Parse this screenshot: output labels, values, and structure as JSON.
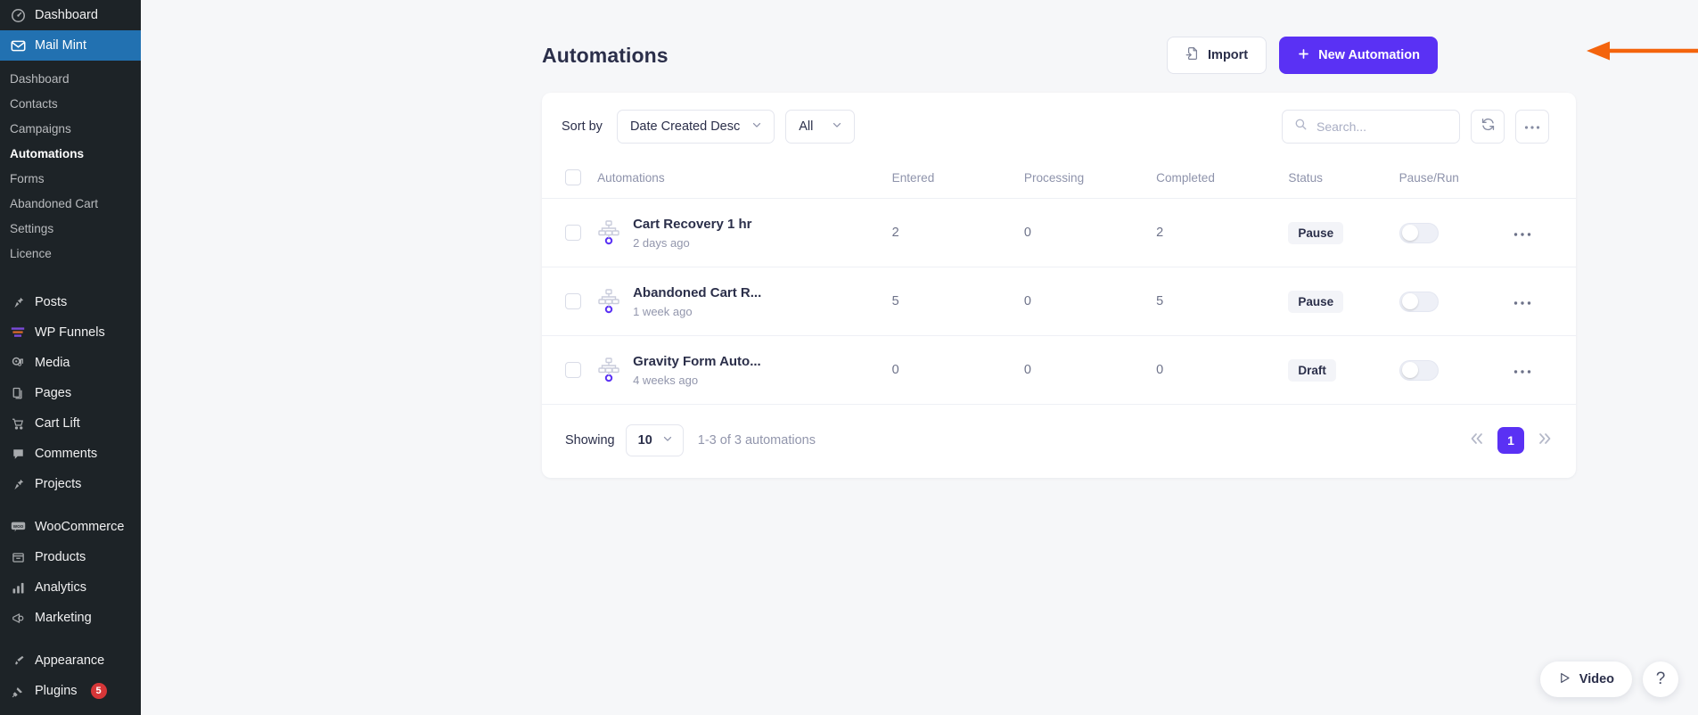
{
  "theme": {
    "accent": "#5a31f4",
    "sidebar_bg": "#1d2327",
    "sidebar_active_bg": "#2271b1",
    "page_bg": "#f6f7f9",
    "annotation_arrow": "#f4640d",
    "badge_red": "#d63638"
  },
  "sidebar": {
    "top_items": [
      {
        "label": "Dashboard",
        "icon": "dashboard-icon",
        "current": false
      },
      {
        "label": "Mail Mint",
        "icon": "mail-icon",
        "current": true
      }
    ],
    "submenu": [
      {
        "label": "Dashboard",
        "active": false
      },
      {
        "label": "Contacts",
        "active": false
      },
      {
        "label": "Campaigns",
        "active": false
      },
      {
        "label": "Automations",
        "active": true
      },
      {
        "label": "Forms",
        "active": false
      },
      {
        "label": "Abandoned Cart",
        "active": false
      },
      {
        "label": "Settings",
        "active": false
      },
      {
        "label": "Licence",
        "active": false
      }
    ],
    "group_two": [
      {
        "label": "Posts",
        "icon": "pin-icon"
      },
      {
        "label": "WP Funnels",
        "icon": "funnel-icon"
      },
      {
        "label": "Media",
        "icon": "media-icon"
      },
      {
        "label": "Pages",
        "icon": "pages-icon"
      },
      {
        "label": "Cart Lift",
        "icon": "cart-icon"
      },
      {
        "label": "Comments",
        "icon": "comment-icon"
      },
      {
        "label": "Projects",
        "icon": "pin-icon"
      }
    ],
    "group_three": [
      {
        "label": "WooCommerce",
        "icon": "woo-icon"
      },
      {
        "label": "Products",
        "icon": "products-icon"
      },
      {
        "label": "Analytics",
        "icon": "analytics-icon"
      },
      {
        "label": "Marketing",
        "icon": "megaphone-icon"
      }
    ],
    "group_four": [
      {
        "label": "Appearance",
        "icon": "brush-icon",
        "badge": ""
      },
      {
        "label": "Plugins",
        "icon": "plug-icon",
        "badge": "5"
      }
    ]
  },
  "header": {
    "title": "Automations",
    "import_label": "Import",
    "import_icon": "file-import-icon",
    "new_label": "New Automation",
    "new_icon": "plus-icon"
  },
  "toolbar": {
    "sort_label": "Sort by",
    "sort_value": "Date Created Desc",
    "filter_value": "All",
    "search_placeholder": "Search...",
    "search_value": "",
    "search_icon": "search-icon",
    "refresh_icon": "refresh-icon",
    "more_icon": "more-horizontal-icon",
    "chevron_icon": "chevron-down-icon"
  },
  "table": {
    "columns": [
      "Automations",
      "Entered",
      "Processing",
      "Completed",
      "Status",
      "Pause/Run"
    ],
    "rows": [
      {
        "name": "Cart Recovery 1 hr",
        "time": "2 days ago",
        "entered": "2",
        "processing": "0",
        "completed": "2",
        "status": "Pause",
        "toggle_on": false,
        "icon": "automation-flow-icon",
        "menu_icon": "more-horizontal-icon"
      },
      {
        "name": "Abandoned Cart R...",
        "time": "1 week ago",
        "entered": "5",
        "processing": "0",
        "completed": "5",
        "status": "Pause",
        "toggle_on": false,
        "icon": "automation-flow-icon",
        "menu_icon": "more-horizontal-icon"
      },
      {
        "name": "Gravity Form Auto...",
        "time": "4 weeks ago",
        "entered": "0",
        "processing": "0",
        "completed": "0",
        "status": "Draft",
        "toggle_on": false,
        "icon": "automation-flow-icon",
        "menu_icon": "more-horizontal-icon"
      }
    ]
  },
  "footer": {
    "showing_label": "Showing",
    "per_page": "10",
    "range_text": "1-3 of 3 automations",
    "first_page_icon": "chevron-double-left-icon",
    "last_page_icon": "chevron-double-right-icon",
    "current_page": "1"
  },
  "floating": {
    "video_label": "Video",
    "video_icon": "play-icon",
    "help_label": "?",
    "help_icon": "question-mark-icon"
  }
}
